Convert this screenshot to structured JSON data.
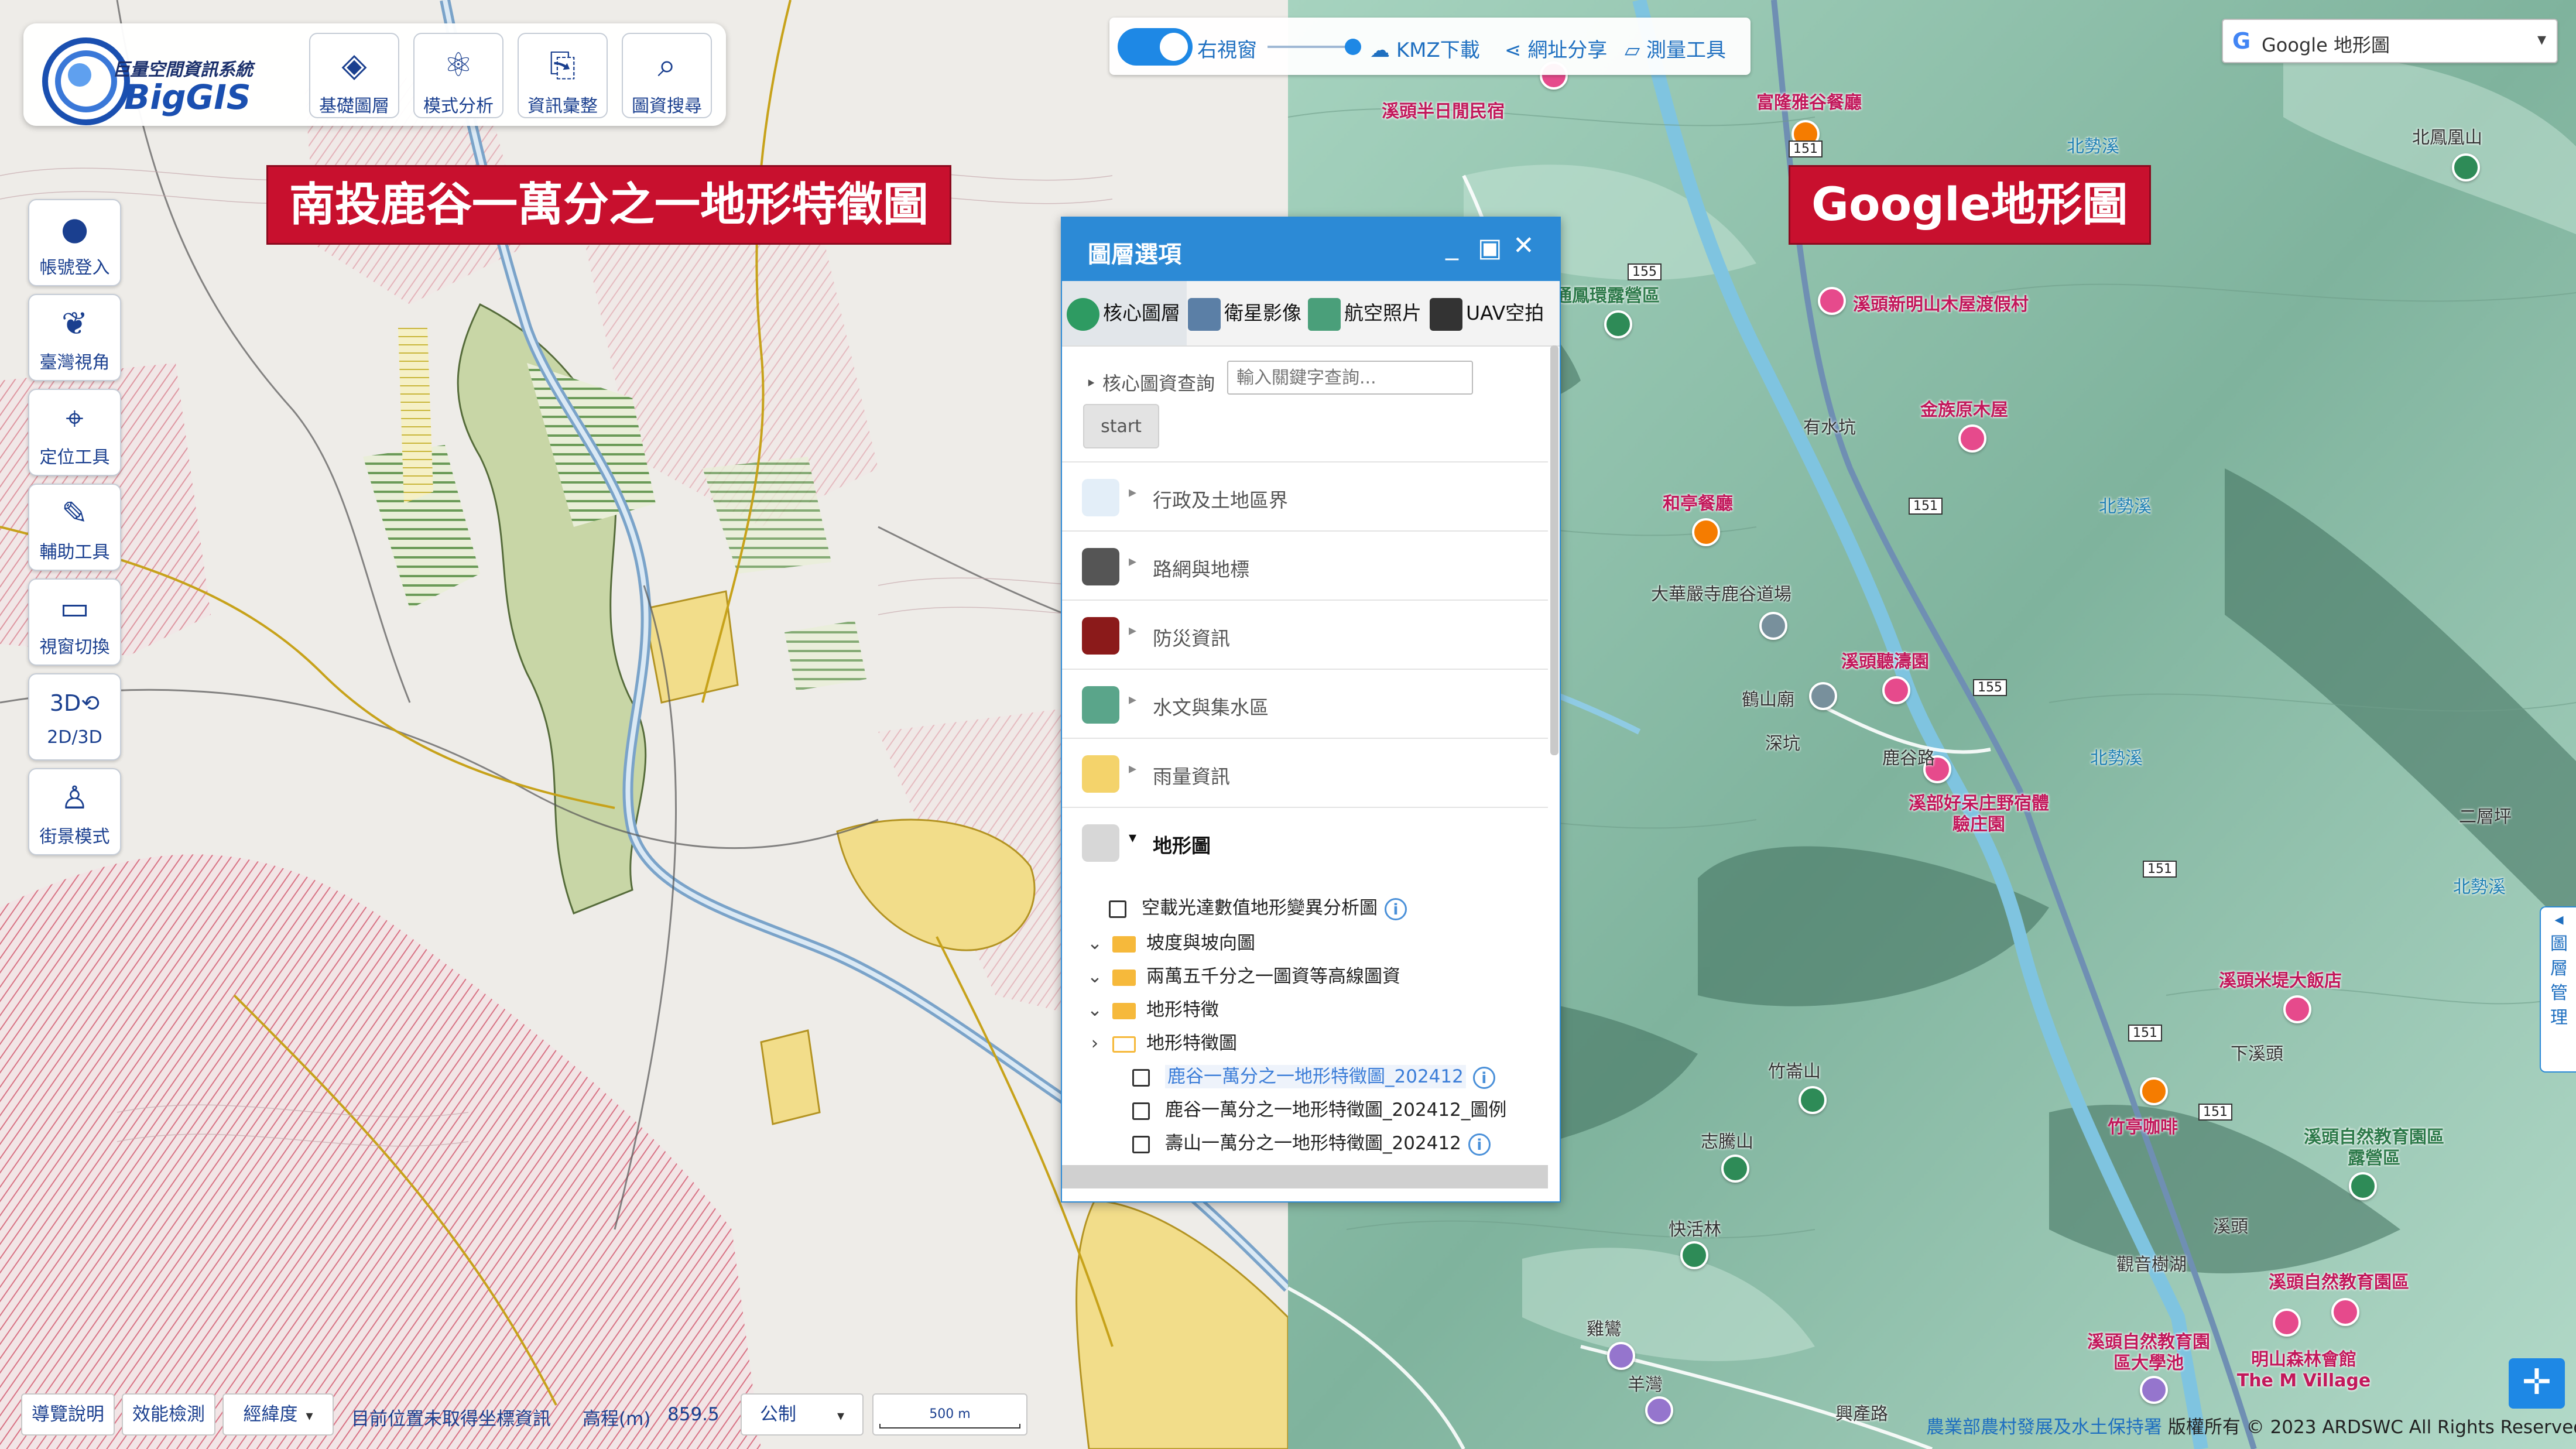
{
  "logo": {
    "title_cn": "巨量空間資訊系統",
    "title_en": "BigGIS"
  },
  "top_toolbar": [
    {
      "id": "base-layer",
      "label": "基礎圖層",
      "icon": "layers-icon"
    },
    {
      "id": "model-analysis",
      "label": "模式分析",
      "icon": "analysis-icon"
    },
    {
      "id": "info-compile",
      "label": "資訊彙整",
      "icon": "info-doc-icon"
    },
    {
      "id": "map-search",
      "label": "圖資搜尋",
      "icon": "map-search-icon"
    }
  ],
  "side_toolbar": [
    {
      "id": "login",
      "label": "帳號登入",
      "icon": "user-icon"
    },
    {
      "id": "taiwan-view",
      "label": "臺灣視角",
      "icon": "taiwan-icon"
    },
    {
      "id": "locate",
      "label": "定位工具",
      "icon": "pin-icon"
    },
    {
      "id": "aux",
      "label": "輔助工具",
      "icon": "tools-icon"
    },
    {
      "id": "view-switch",
      "label": "視窗切換",
      "icon": "window-icon"
    },
    {
      "id": "dim-switch",
      "label": "2D/3D",
      "icon": "3d-icon"
    },
    {
      "id": "street-view",
      "label": "街景模式",
      "icon": "pegman-icon"
    }
  ],
  "banners": {
    "left": "南投鹿谷一萬分之一地形特徵圖",
    "right": "Google地形圖"
  },
  "top_controls": {
    "right_window": "右視窗",
    "kmz": "KMZ下載",
    "share": "網址分享",
    "measure": "測量工具"
  },
  "basemap_select": {
    "value": "Google 地形圖"
  },
  "layer_panel": {
    "title": "圖層選項",
    "tabs": [
      "核心圖層",
      "衛星影像",
      "航空照片",
      "UAV空拍"
    ],
    "query_label": "核心圖資查詢",
    "query_placeholder": "輸入關鍵字查詢...",
    "start_label": "start",
    "categories": [
      "行政及土地區界",
      "路網與地標",
      "防災資訊",
      "水文與集水區",
      "雨量資訊",
      "地形圖"
    ],
    "tree": [
      {
        "type": "check",
        "label": "空載光達數值地形變異分析圖",
        "info": true
      },
      {
        "type": "folder",
        "label": "坡度與坡向圖"
      },
      {
        "type": "folder",
        "label": "兩萬五千分之一圖資等高線圖資"
      },
      {
        "type": "folder",
        "label": "地形特徵"
      },
      {
        "type": "folder",
        "label": "地形特徵圖"
      },
      {
        "type": "check",
        "label": "鹿谷一萬分之一地形特徵圖_202412",
        "info": true
      },
      {
        "type": "check",
        "label": "鹿谷一萬分之一地形特徵圖_202412_圖例",
        "info": false
      },
      {
        "type": "check",
        "label": "壽山一萬分之一地形特徵圖_202412",
        "info": true
      }
    ]
  },
  "status_bar": {
    "guide": "導覽說明",
    "perf": "效能檢測",
    "coord_type": "經緯度",
    "coord_msg": "目前位置未取得坐標資訊",
    "elev_label": "高程(m)",
    "elev_value": "859.5",
    "unit": "公制",
    "scale": "500 m"
  },
  "right_map": {
    "labels": [
      "溪頭半日閒民宿",
      "富隆雅谷餐廳",
      "通鳳環露營區",
      "溪頭新明山木屋渡假村",
      "金族原木屋",
      "和亭餐廳",
      "大華嚴寺鹿谷道場",
      "溪頭聽濤園",
      "鶴山廟",
      "深坑",
      "溪部好呆庄野宿體驗庄園",
      "有水坑",
      "北鳳凰山",
      "竹崙山",
      "竹亭咖啡",
      "志騰山",
      "快活林",
      "溪頭米堤大飯店",
      "下溪頭",
      "溪頭自然教育園區露營區",
      "溪頭",
      "觀音樹湖",
      "溪頭自然教育園區",
      "溪頭自然教育園區大學池",
      "明山森林會館 The M Village",
      "雞鸞",
      "羊灣",
      "興產路",
      "二層坪",
      "北勢溪",
      "鹿谷路"
    ],
    "road_shields": [
      "151",
      "151",
      "151",
      "151",
      "155",
      "155",
      "151"
    ]
  },
  "copyright": {
    "agency": "農業部農村發展及水土保持署",
    "text": "版權所有 © 2023 ARDSWC All Rights Reserved."
  },
  "side_tab": [
    "圖",
    "層",
    "管",
    "理"
  ]
}
